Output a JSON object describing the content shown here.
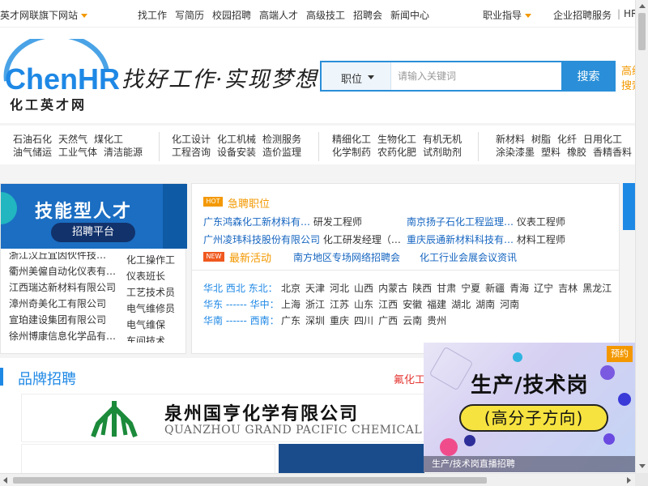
{
  "topbar": {
    "network_label": "英才网联旗下网站",
    "nav": [
      "找工作",
      "写简历",
      "校园招聘",
      "高端人才",
      "高级技工",
      "招聘会",
      "新闻中心"
    ],
    "career_guide": "职业指导",
    "enterprise": "企业招聘服务",
    "sep": "|",
    "hr": "HR"
  },
  "header": {
    "logo_text": "ChenHR",
    "logo_cn": "化工英才网",
    "slogan": "找好工作·实现梦想",
    "search": {
      "type_label": "职位",
      "placeholder": "请输入关键词",
      "button_label": "搜索"
    },
    "side_links": [
      "高级",
      "搜索"
    ]
  },
  "categories": [
    {
      "row1": [
        "石油石化",
        "天然气",
        "煤化工"
      ],
      "row2": [
        "油气储运",
        "工业气体",
        "清洁能源"
      ]
    },
    {
      "row1": [
        "化工设计",
        "化工机械",
        "检测服务"
      ],
      "row2": [
        "工程咨询",
        "设备安装",
        "造价监理"
      ]
    },
    {
      "row1": [
        "精细化工",
        "生物化工",
        "有机无机"
      ],
      "row2": [
        "化学制药",
        "农药化肥",
        "试剂助剂"
      ]
    },
    {
      "row1": [
        "新材料",
        "树脂",
        "化纤",
        "日用化工"
      ],
      "row2": [
        "涂染漆墨",
        "塑料",
        "橡胶",
        "香精香料"
      ]
    }
  ],
  "banner": {
    "title": "技能型人才",
    "subtitle": "招聘平台"
  },
  "left_list": [
    {
      "company": "浙江汉丘宜因伙件技…",
      "job": "化工操作工"
    },
    {
      "company": "衢州美僱自动化仪表有…",
      "job": "仪表班长"
    },
    {
      "company": "江西瑞达新材料有限公司",
      "job": "工艺技术员"
    },
    {
      "company": "漳州奇美化工有限公司",
      "job": "电气维修员"
    },
    {
      "company": "宣珀建设集团有限公司",
      "job": "电气维保"
    },
    {
      "company": "徐州博康信息化学品有…",
      "job": "车间技术"
    }
  ],
  "urgent": {
    "badge": "HOT",
    "title": "急聘职位",
    "rows": [
      [
        {
          "company": "广东鸿森化工新材料有…",
          "job": "研发工程师"
        },
        {
          "company": "南京扬子石化工程监理…",
          "job": "仪表工程师"
        }
      ],
      [
        {
          "company": "广州凌玮科技股份有限公司",
          "job": "化工研发经理（…"
        },
        {
          "company": "重庆辰通新材料科技有…",
          "job": "材料工程师"
        }
      ]
    ]
  },
  "activity": {
    "badge": "NEW",
    "title": "最新活动",
    "items": [
      "南方地区专场网络招聘会",
      "化工行业会展会议资讯"
    ]
  },
  "regions": [
    {
      "label": "华北 西北 东北：",
      "cities": [
        "北京",
        "天津",
        "河北",
        "山西",
        "内蒙古",
        "陕西",
        "甘肃",
        "宁夏",
        "新疆",
        "青海",
        "辽宁",
        "吉林",
        "黑龙江"
      ]
    },
    {
      "label": "华东 ------ 华中：",
      "cities": [
        "上海",
        "浙江",
        "江苏",
        "山东",
        "江西",
        "安徽",
        "福建",
        "湖北",
        "湖南",
        "河南"
      ]
    },
    {
      "label": "华南 ------ 西南：",
      "cities": [
        "广东",
        "深圳",
        "重庆",
        "四川",
        "广西",
        "云南",
        "贵州"
      ]
    }
  ],
  "brand": {
    "title": "品牌招聘",
    "red_text": "氟化工",
    "company_cn": "泉州国亨化学有限公司",
    "company_en": "QUANZHOU GRAND PACIFIC CHEMICAL"
  },
  "popup": {
    "tag": "预约",
    "line1": "生产/技术岗",
    "line2": "(高分子方向)",
    "caption": "生产/技术岗直播招聘"
  },
  "colors": {
    "brand_blue": "#1e88e5",
    "search_blue": "#2a8fd8",
    "accent_orange": "#f39800",
    "link_blue": "#1565c0"
  }
}
